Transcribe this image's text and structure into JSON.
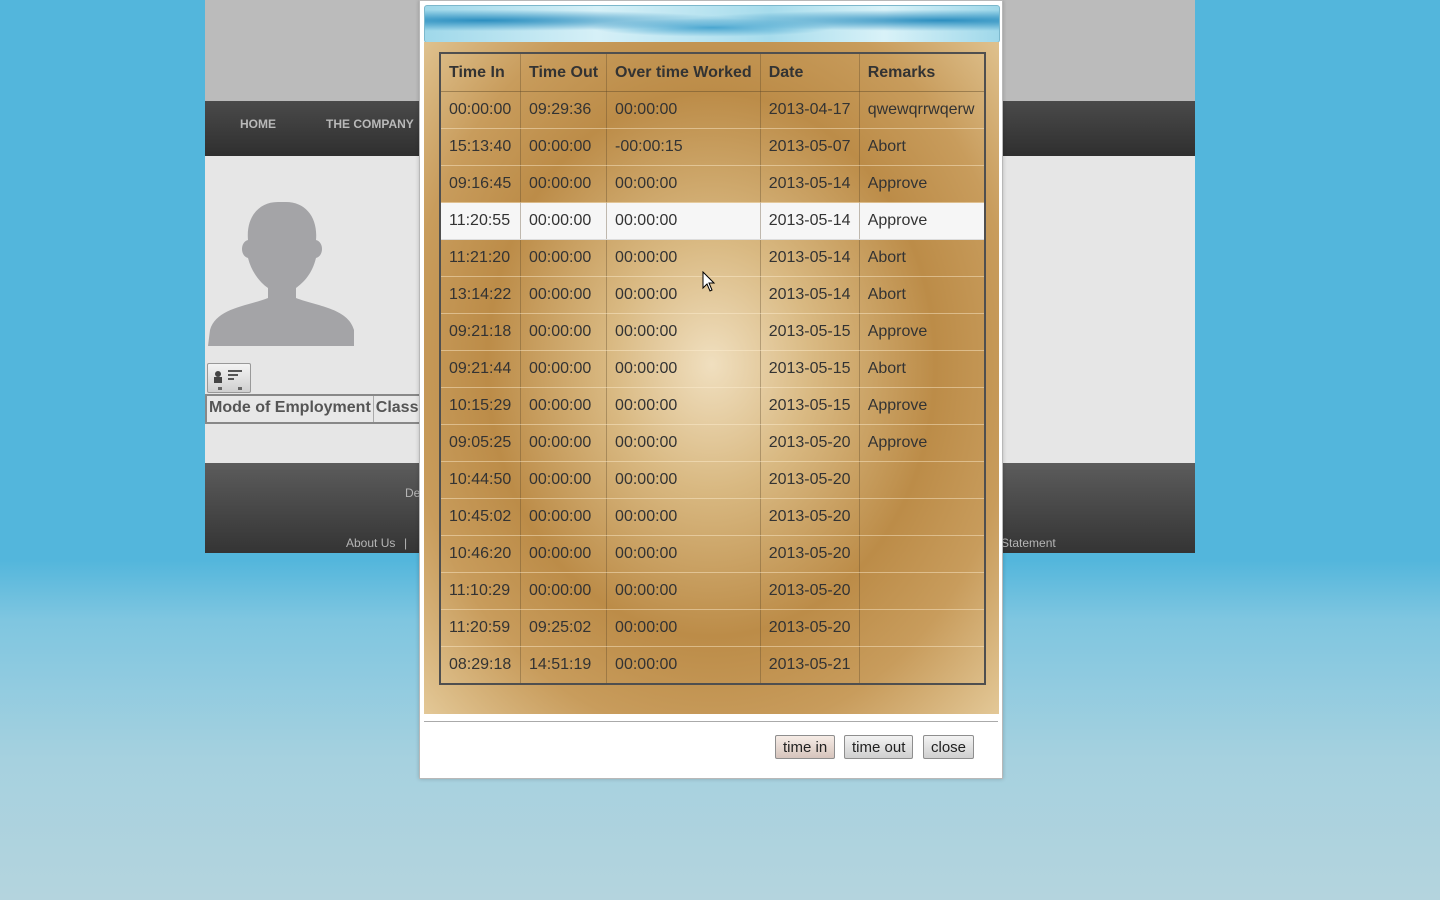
{
  "site": {
    "nav": [
      "HOME",
      "THE COMPANY"
    ],
    "employment_headers": [
      "Mode of Employment",
      "Classi"
    ],
    "footer_partial": "De",
    "footer_links": [
      "About Us",
      "|"
    ],
    "footer_right": "Statement"
  },
  "dialog": {
    "columns": [
      "Time In",
      "Time Out",
      "Over time Worked",
      "Date",
      "Remarks"
    ],
    "rows": [
      [
        "00:00:00",
        "09:29:36",
        "00:00:00",
        "2013-04-17",
        "qwewqrrwqerw"
      ],
      [
        "15:13:40",
        "00:00:00",
        "-00:00:15",
        "2013-05-07",
        "Abort"
      ],
      [
        "09:16:45",
        "00:00:00",
        "00:00:00",
        "2013-05-14",
        "Approve"
      ],
      [
        "11:20:55",
        "00:00:00",
        "00:00:00",
        "2013-05-14",
        "Approve"
      ],
      [
        "11:21:20",
        "00:00:00",
        "00:00:00",
        "2013-05-14",
        "Abort"
      ],
      [
        "13:14:22",
        "00:00:00",
        "00:00:00",
        "2013-05-14",
        "Abort"
      ],
      [
        "09:21:18",
        "00:00:00",
        "00:00:00",
        "2013-05-15",
        "Approve"
      ],
      [
        "09:21:44",
        "00:00:00",
        "00:00:00",
        "2013-05-15",
        "Abort"
      ],
      [
        "10:15:29",
        "00:00:00",
        "00:00:00",
        "2013-05-15",
        "Approve"
      ],
      [
        "09:05:25",
        "00:00:00",
        "00:00:00",
        "2013-05-20",
        "Approve"
      ],
      [
        "10:44:50",
        "00:00:00",
        "00:00:00",
        "2013-05-20",
        ""
      ],
      [
        "10:45:02",
        "00:00:00",
        "00:00:00",
        "2013-05-20",
        ""
      ],
      [
        "10:46:20",
        "00:00:00",
        "00:00:00",
        "2013-05-20",
        ""
      ],
      [
        "11:10:29",
        "00:00:00",
        "00:00:00",
        "2013-05-20",
        ""
      ],
      [
        "11:20:59",
        "09:25:02",
        "00:00:00",
        "2013-05-20",
        ""
      ],
      [
        "08:29:18",
        "14:51:19",
        "00:00:00",
        "2013-05-21",
        ""
      ]
    ],
    "selected_row_index": 3,
    "buttons": {
      "time_in": "time in",
      "time_out": "time out",
      "close": "close"
    }
  },
  "icons": {
    "avatar": "person-silhouette-icon",
    "profile_card": "id-card-icon",
    "cursor": "mouse-pointer-icon"
  }
}
